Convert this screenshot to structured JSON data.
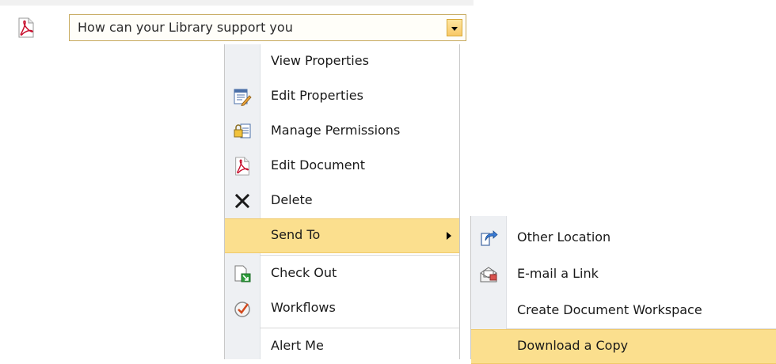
{
  "document": {
    "title": "How can your Library support you",
    "type_icon": "pdf-icon"
  },
  "context_menu": {
    "items": [
      {
        "label": "View Properties",
        "icon": ""
      },
      {
        "label": "Edit Properties",
        "icon": "edit-properties-icon"
      },
      {
        "label": "Manage Permissions",
        "icon": "manage-permissions-icon"
      },
      {
        "label": "Edit Document",
        "icon": "pdf-icon"
      },
      {
        "label": "Delete",
        "icon": "delete-x-icon"
      },
      {
        "label": "Send To",
        "icon": "",
        "highlighted": true,
        "has_submenu": true
      },
      {
        "label": "Check Out",
        "icon": "check-out-icon"
      },
      {
        "label": "Workflows",
        "icon": "workflows-icon"
      },
      {
        "label": "Alert Me",
        "icon": ""
      }
    ]
  },
  "send_to_submenu": {
    "items": [
      {
        "label": "Other Location",
        "icon": "other-location-icon"
      },
      {
        "label": "E-mail a Link",
        "icon": "email-link-icon"
      },
      {
        "label": "Create Document Workspace",
        "icon": ""
      },
      {
        "label": "Download a Copy",
        "icon": "",
        "highlighted": true
      }
    ]
  },
  "colors": {
    "highlight": "#fbdf8e",
    "highlight_border": "#f0c96a",
    "gutter": "#eef0f3",
    "title_border": "#c6a95c"
  }
}
